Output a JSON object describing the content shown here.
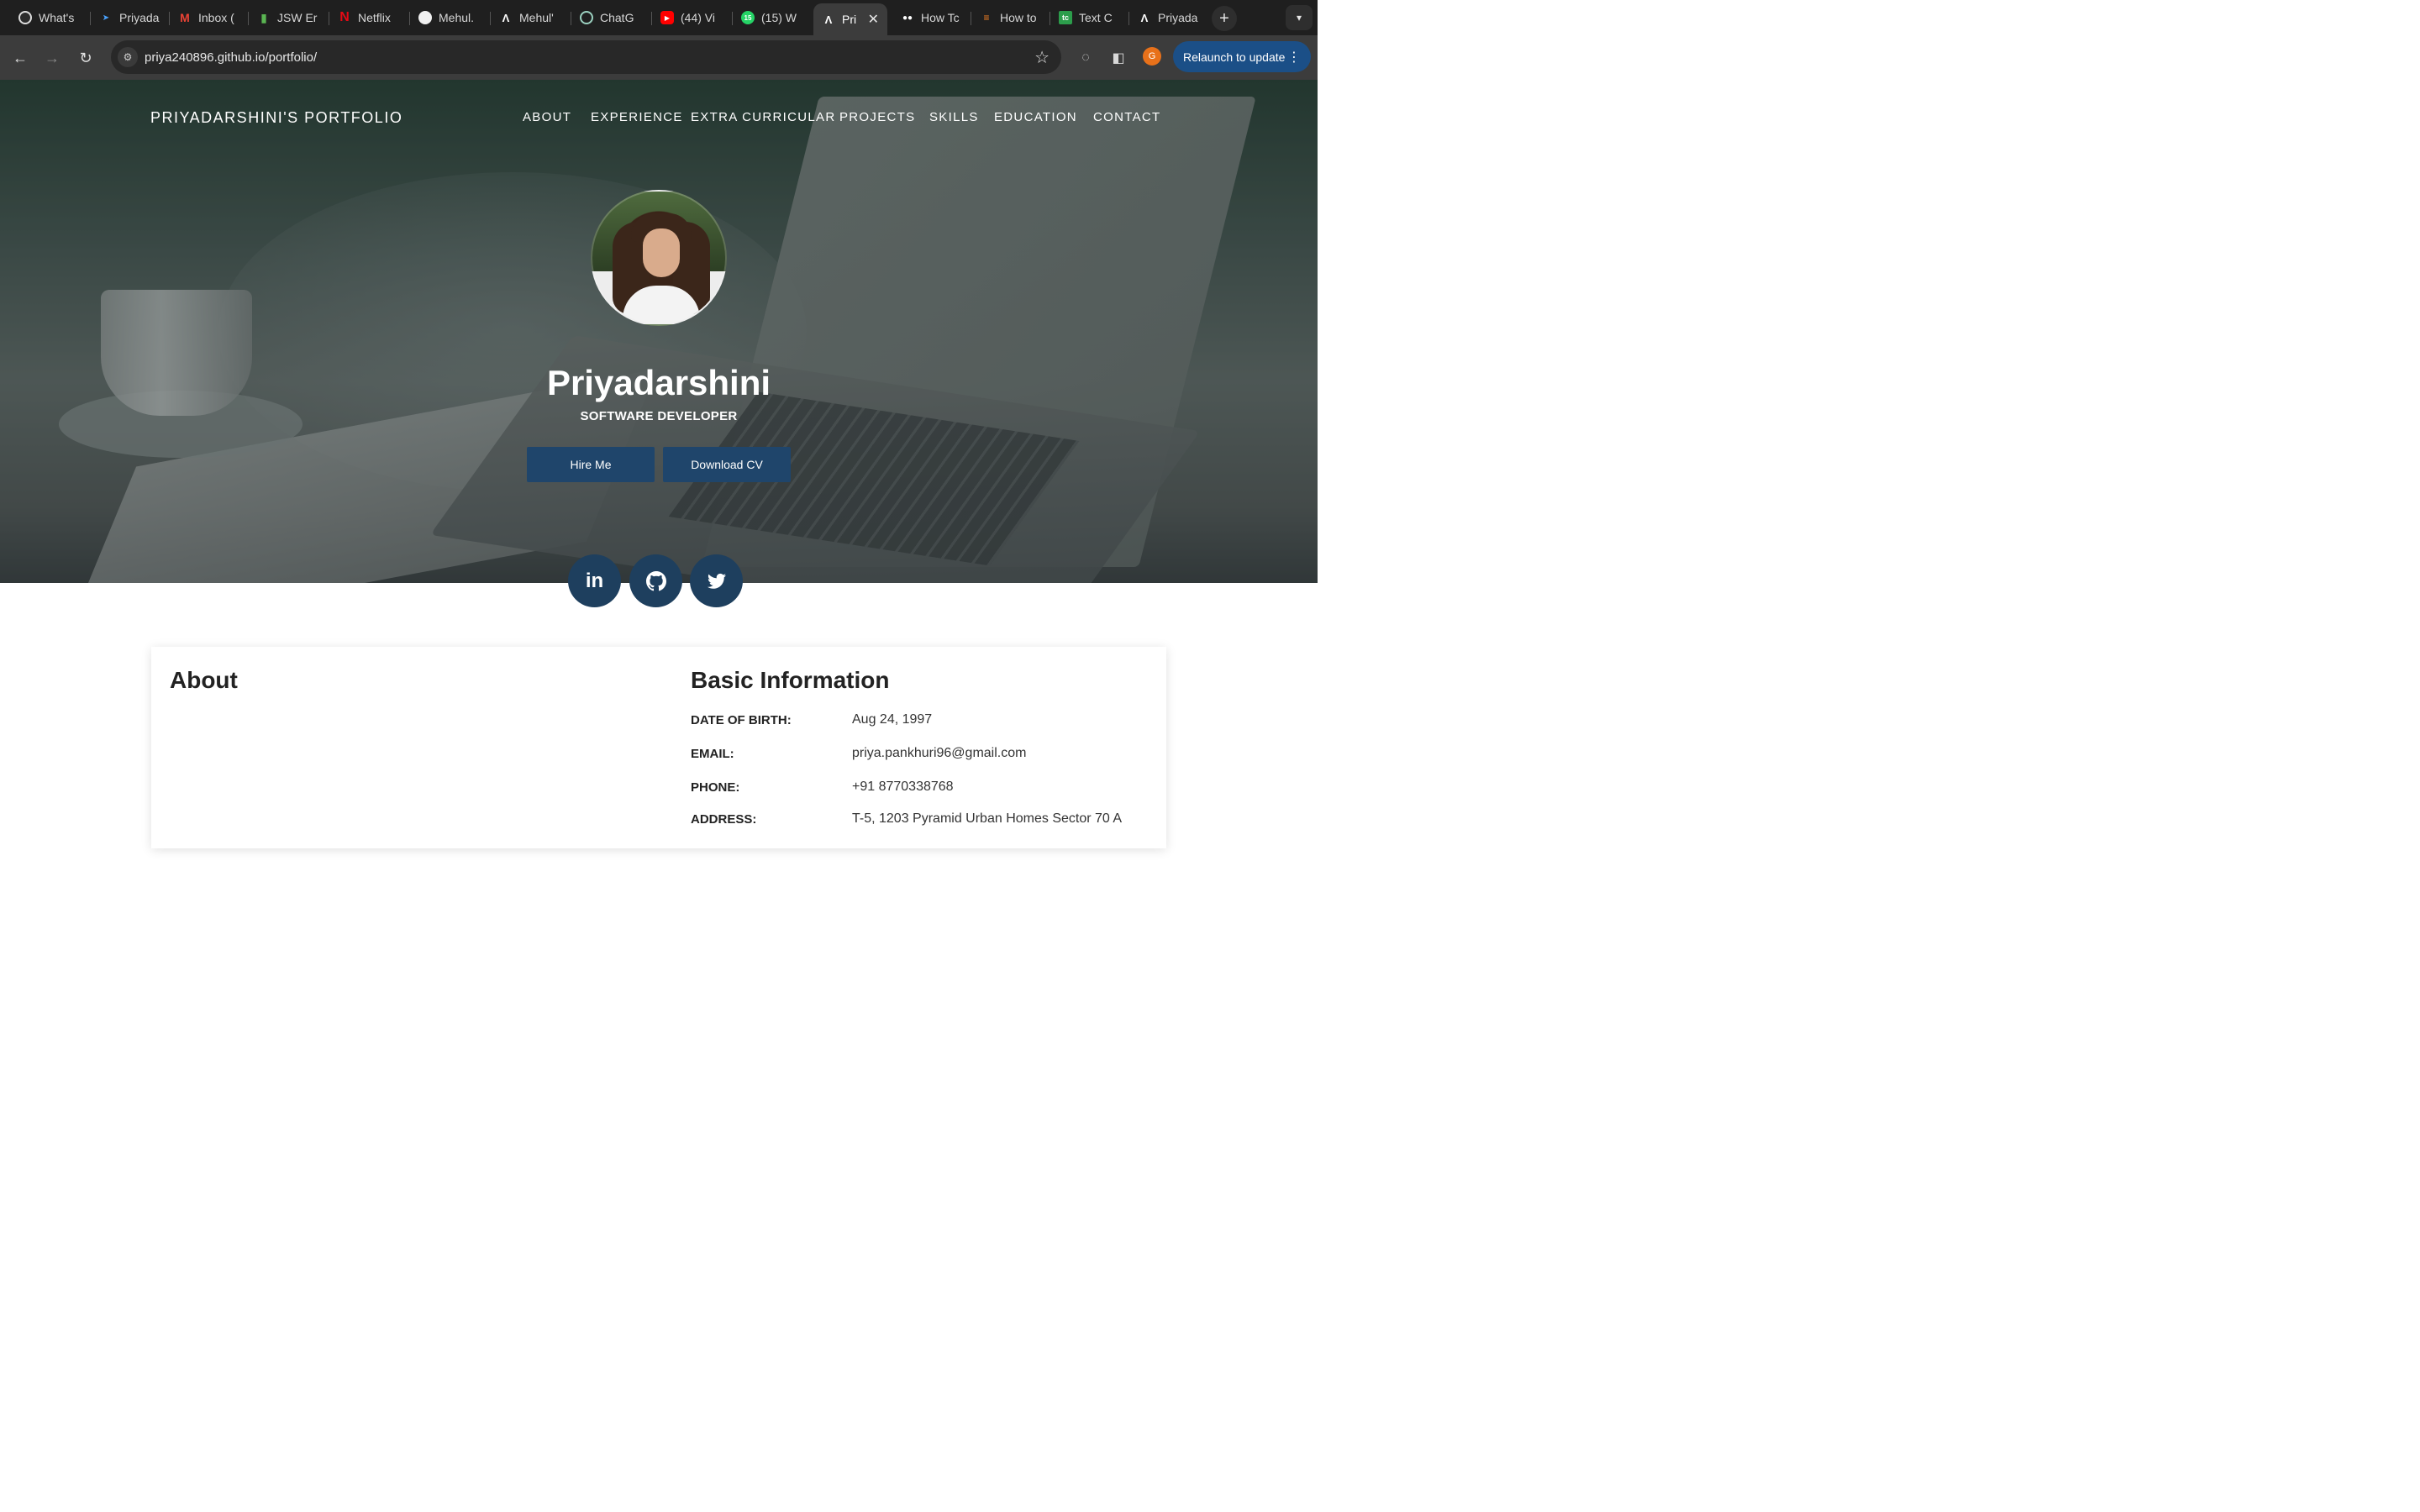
{
  "browser": {
    "tabs": [
      {
        "label": "What's",
        "icon": "chrome-icon"
      },
      {
        "label": "Priyada",
        "icon": "bird-icon"
      },
      {
        "label": "Inbox (",
        "icon": "gmail-icon"
      },
      {
        "label": "JSW Er",
        "icon": "bar-chart-icon"
      },
      {
        "label": "Netflix",
        "icon": "netflix-icon"
      },
      {
        "label": "Mehul.",
        "icon": "github-icon"
      },
      {
        "label": "Mehul'",
        "icon": "letter-a-icon"
      },
      {
        "label": "ChatG",
        "icon": "chatgpt-icon"
      },
      {
        "label": "(44) Vi",
        "icon": "youtube-icon"
      },
      {
        "label": "(15) W",
        "icon": "whatsapp-icon",
        "badge": "15"
      },
      {
        "label": "Pri",
        "icon": "letter-a-icon",
        "active": true
      },
      {
        "label": "How Tc",
        "icon": "medium-icon"
      },
      {
        "label": "How to",
        "icon": "stackoverflow-icon"
      },
      {
        "label": "Text C",
        "icon": "tc-icon",
        "favicon_text": "tc"
      },
      {
        "label": "Priyada",
        "icon": "letter-a-icon"
      }
    ],
    "url": "priya240896.github.io/portfolio/",
    "relaunch_label": "Relaunch to update",
    "profile_initial": "G",
    "colors": {
      "tabstrip": "#1f1f1f",
      "toolbar": "#3c3c3c",
      "relaunch": "#1b4f87",
      "avatar": "#e8711a"
    }
  },
  "site": {
    "brand": "PRIYADARSHINI'S PORTFOLIO",
    "nav": [
      "ABOUT",
      "EXPERIENCE",
      "EXTRA CURRICULAR",
      "PROJECTS",
      "SKILLS",
      "EDUCATION",
      "CONTACT"
    ],
    "name": "Priyadarshini",
    "role": "SOFTWARE DEVELOPER",
    "buttons": {
      "hire": "Hire Me",
      "cv": "Download CV"
    },
    "social": [
      "linkedin-icon",
      "github-icon",
      "twitter-icon"
    ],
    "social_text": {
      "linkedin": "in"
    },
    "accent": "#1f456b"
  },
  "about": {
    "title": "About",
    "basic_title": "Basic Information",
    "fields": [
      {
        "label": "DATE OF BIRTH:",
        "value": "Aug 24, 1997"
      },
      {
        "label": "EMAIL:",
        "value": "priya.pankhuri96@gmail.com"
      },
      {
        "label": "PHONE:",
        "value": "+91 8770338768"
      },
      {
        "label": "ADDRESS:",
        "value": "T-5, 1203 Pyramid Urban Homes Sector 70 A"
      }
    ]
  }
}
